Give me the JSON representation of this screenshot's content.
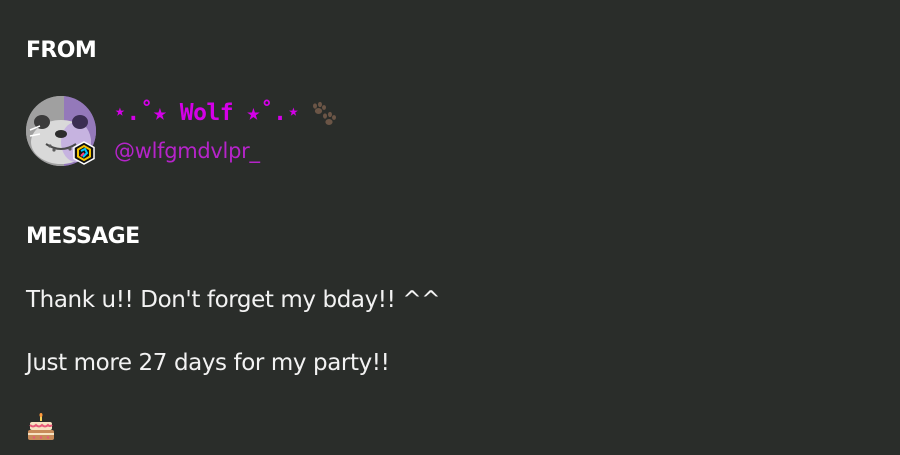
{
  "from": {
    "heading": "FROM",
    "user": {
      "display_name": "⋆.˚★ Wolf ★˚.⋆",
      "display_name_icon": "paw-prints-icon",
      "username": "@wlfgmdvlpr_",
      "avatar_icon": "seal-avatar",
      "badge_icon": "hexagon-badge-icon",
      "name_color": "#d400e8",
      "username_color": "#b524c9"
    }
  },
  "message": {
    "heading": "MESSAGE",
    "lines": [
      "Thank u!! Don't forget my bday!! ^^",
      "Just more 27 days for my party!!"
    ],
    "emoji_icon": "birthday-cake-icon"
  },
  "colors": {
    "background": "#2a2d2a",
    "text": "#ffffff"
  }
}
